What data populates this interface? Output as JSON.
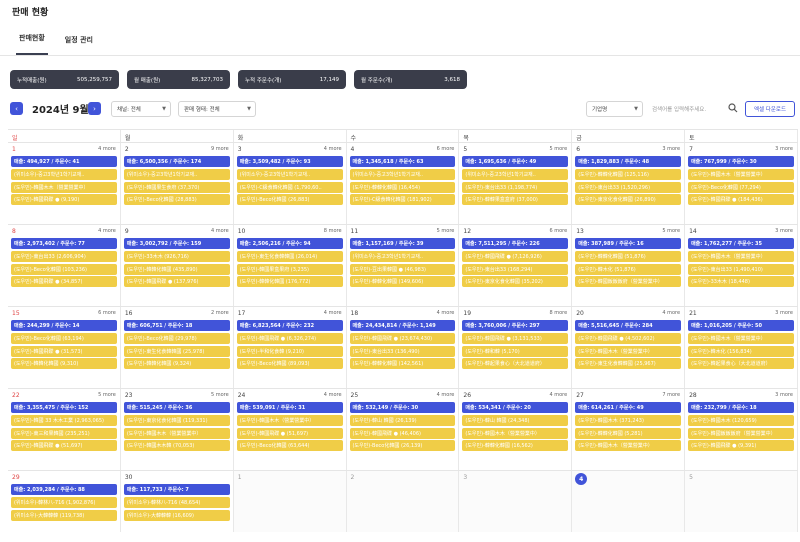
{
  "page_title": "판매 현황",
  "tabs": [
    {
      "label": "판매현황"
    },
    {
      "label": "일정 관리"
    }
  ],
  "stats": [
    {
      "label": "누적매출(원)",
      "value": "505,259,757"
    },
    {
      "label": "월 매출(원)",
      "value": "85,327,703"
    },
    {
      "label": "누적 주문수(개)",
      "value": "17,149"
    },
    {
      "label": "월 주문수(개)",
      "value": "3,618"
    }
  ],
  "controls": {
    "prev": "‹",
    "next": "›",
    "month": "2024년 9월",
    "channel": "채널: 전체",
    "sales_type": "판매 형태: 전체",
    "company": "기업명",
    "search_placeholder": "검색어를 입력해주세요.",
    "excel": "엑셀 다운로드"
  },
  "days_of_week": [
    "일",
    "월",
    "화",
    "수",
    "목",
    "금",
    "토"
  ],
  "weeks": [
    [
      {
        "date": "1",
        "more": "4 more",
        "events": [
          "매출: 494,927 / 주문수: 41",
          "(위미소우)-중고3학년1학기교재..",
          "(도우민)-韓國木木（營業營業中）",
          "(도우민)-韓國飛碟 ● (9,190)"
        ]
      },
      {
        "date": "2",
        "more": "9 more",
        "events": [
          "매출: 6,500,356 / 주문수: 174",
          "(위미소우)-중고3학년1학기교재..",
          "(도우민)-韓國果生食府 (37,370)",
          "(도우민)-Beco化韓國 (28,883)"
        ]
      },
      {
        "date": "3",
        "more": "4 more",
        "events": [
          "매출: 3,509,482 / 주문수: 93",
          "(위미소우)-중고3학년1학기교재..",
          "(도우민)-C級食韓化韓國 (1,790,60..",
          "(도우민)-Beco化韓國 (26,883)"
        ]
      },
      {
        "date": "4",
        "more": "6 more",
        "events": [
          "매출: 1,345,618 / 주문수: 63",
          "(위미소우)-중고3학년1학기교재..",
          "(도우민)-韓韓化韓國 (16,454)",
          "(도우민)-C級食韓化韓國 (181,902)"
        ]
      },
      {
        "date": "5",
        "more": "5 more",
        "events": [
          "매출: 1,695,636 / 주문수: 49",
          "(위미소우)-중고3학년1학기교재..",
          "(도우민)-東台出33 (1,198,774)",
          "(도우민)-韓韓果盒盒府 (37,000)"
        ]
      },
      {
        "date": "6",
        "more": "3 more",
        "events": [
          "매출: 1,829,883 / 주문수: 48",
          "(도우민)-韓韓化韓國 (125,116)",
          "(도우민)-東台出33 (1,520,296)",
          "(도우민)-東京化食化韓國 (26,890)"
        ]
      },
      {
        "date": "7",
        "more": "3 more",
        "events": [
          "매출: 767,999 / 주문수: 30",
          "(도우민)-韓國木木（營業營業中）",
          "(도우민)-Beco化韓國 (77,294)",
          "(도우민)-韓國飛碟 ● (184,436)"
        ]
      }
    ],
    [
      {
        "date": "8",
        "more": "4 more",
        "events": [
          "매출: 2,973,402 / 주문수: 77",
          "(도우민)-東台出33 (2,606,904)",
          "(도우민)-Beco化韓國 (103,236)",
          "(도우민)-韓國飛碟 ● (34,857)"
        ]
      },
      {
        "date": "9",
        "more": "4 more",
        "events": [
          "매출: 3,002,792 / 주문수: 159",
          "(도우민)-33木木 (926,716)",
          "(도우민)-韓韓化韓國 (435,890)",
          "(도우민)-韓國飛碟 ● (137,976)"
        ]
      },
      {
        "date": "10",
        "more": "8 more",
        "events": [
          "매출: 2,506,216 / 주문수: 94",
          "(도우민)-東生化食韓韓國 (26,014)",
          "(도우민)-韓國果盒果府 (3,235)",
          "(도우민)-韓韓化韓國 (176,772)"
        ]
      },
      {
        "date": "11",
        "more": "5 more",
        "events": [
          "매출: 1,157,169 / 주문수: 39",
          "(위미소우)-중고3학년1학기교재..",
          "(도우민)-豆出果韓國 ● (46,983)",
          "(도우민)-韓韓化韓國 (149,606)"
        ]
      },
      {
        "date": "12",
        "more": "6 more",
        "events": [
          "매출: 7,511,295 / 주문수: 226",
          "(도우민)-韓國飛碟 ● (7,126,926)",
          "(도우민)-東台出33 (168,294)",
          "(도우민)-東京化食化韓國 (35,202)"
        ]
      },
      {
        "date": "13",
        "more": "5 more",
        "events": [
          "매출: 387,989 / 주문수: 16",
          "(도우민)-韓韓化韓國 (51,876)",
          "(도우민)-韓木化 (51,876)",
          "(도우민)-韓國飯飯飯府（營業營業中）"
        ]
      },
      {
        "date": "14",
        "more": "3 more",
        "events": [
          "매출: 1,762,277 / 주문수: 35",
          "(도우민)-韓國木木（營業營業中）",
          "(도우민)-東台出33 (1,490,410)",
          "(도우민)-33木木 (18,448)"
        ]
      }
    ],
    [
      {
        "date": "15",
        "more": "6 more",
        "events": [
          "매출: 244,299 / 주문수: 14",
          "(도우민)-Beco化韓國 (63,194)",
          "(도우민)-韓國飛碟 ● (31,573)",
          "(도우민)-韓韓化韓國 (9,310)"
        ]
      },
      {
        "date": "16",
        "more": "2 more",
        "events": [
          "매출: 606,751 / 주문수: 18",
          "(도우민)-Beco化韓國 (29,978)",
          "(도우민)-東生化食韓韓國 (25,978)",
          "(도우민)-韓韓化韓國 (9,324)"
        ]
      },
      {
        "date": "17",
        "more": "4 more",
        "events": [
          "매출: 6,823,564 / 주문수: 232",
          "(도우민)-韓國飛碟 ● (6,326,274)",
          "(도우민)-半和化食韓 (9,210)",
          "(도우민)-Beco化韓國 (89,093)"
        ]
      },
      {
        "date": "18",
        "more": "4 more",
        "events": [
          "매출: 24,434,814 / 주문수: 1,149",
          "(도우민)-韓國飛碟 ● (23,674,430)",
          "(도우민)-東台出33 (136,490)",
          "(도우민)-韓韓化韓國 (142,561)"
        ]
      },
      {
        "date": "19",
        "more": "8 more",
        "events": [
          "매출: 3,760,006 / 주문수: 297",
          "(도우민)-韓國飛碟 ● (3,131,533)",
          "(도우민)-韓和韓 (5,170)",
          "(도우민)-韓起果食心（大北道道府）"
        ]
      },
      {
        "date": "20",
        "more": "4 more",
        "events": [
          "매출: 5,516,645 / 주문수: 284",
          "(도우민)-韓國飛碟 ● (4,502,602)",
          "(도우민)-韓國木木（營業營業中）",
          "(도우민)-東生化食韓韓國 (25,967)"
        ]
      },
      {
        "date": "21",
        "more": "3 more",
        "events": [
          "매출: 1,016,205 / 주문수: 50",
          "(도우민)-韓國木木（營業營業中）",
          "(도우민)-韓木化 (156,834)",
          "(도우민)-韓起果食心（大北道道府）"
        ]
      }
    ],
    [
      {
        "date": "22",
        "more": "5 more",
        "events": [
          "매출: 3,355,475 / 주문수: 152",
          "(도우민)-韓國 33 木木工業 (2,963,065)",
          "(도우민)-東三和果韓國 (235,251)",
          "(도우민)-韓國飛碟 ● (51,697)"
        ]
      },
      {
        "date": "23",
        "more": "5 more",
        "events": [
          "매출: 515,245 / 주문수: 36",
          "(도우민)-東京化食化韓國 (119,331)",
          "(도우민)-韓國木木（營業營業中）",
          "(도우민)-韓國木木韓 (70,053)"
        ]
      },
      {
        "date": "24",
        "more": "4 more",
        "events": [
          "매출: 539,091 / 주문수: 31",
          "(도우민)-韓國木木（營業營業中）",
          "(도우민)-韓國飛碟 ● (51,697)",
          "(도우민)-Beco化韓國 (63,644)"
        ]
      },
      {
        "date": "25",
        "more": "4 more",
        "events": [
          "매출: 532,149 / 주문수: 30",
          "(도우민)-韓山 韓國 (26,139)",
          "(도우민)-韓國飛碟 ● (46,406)",
          "(도우민)-Beco化韓國 (26,139)"
        ]
      },
      {
        "date": "26",
        "more": "4 more",
        "events": [
          "매출: 534,341 / 주문수: 20",
          "(도우민)-韓山 韓國 (24,348)",
          "(도우민)-韓國木木（營業營業中）",
          "(도우민)-韓韓化韓國 (16,562)"
        ]
      },
      {
        "date": "27",
        "more": "7 more",
        "events": [
          "매출: 614,261 / 주문수: 49",
          "(도우민)-韓國木木 (371,243)",
          "(도우민)-韓韓化韓國 (5,281)",
          "(도우민)-韓國木木（營業營業中）"
        ]
      },
      {
        "date": "28",
        "more": "3 more",
        "events": [
          "매출: 232,799 / 주문수: 18",
          "(도우민)-韓國木木 (120,659)",
          "(도우민)-韓國飯飯飯府（營業營業中）",
          "(도우민)-韓國飛碟 ● (9,391)"
        ]
      }
    ],
    [
      {
        "date": "29",
        "more": "",
        "events": [
          "매출: 2,039,284 / 주문수: 88",
          "(위미소우)-韓林八-716 (1,902,876)",
          "(위미소우)-大韓韓韓 (119,738)"
        ]
      },
      {
        "date": "30",
        "more": "",
        "events": [
          "매출: 117,733 / 주문수: 7",
          "(위미소우)-韓林八-716 (48,654)",
          "(위미소우)-大韓韓韓 (16,609)"
        ]
      },
      {
        "date": "1",
        "more": "",
        "events": []
      },
      {
        "date": "2",
        "more": "",
        "events": []
      },
      {
        "date": "3",
        "more": "",
        "events": []
      },
      {
        "date": "4",
        "more": "",
        "events": []
      },
      {
        "date": "5",
        "more": "",
        "events": []
      }
    ]
  ],
  "colors": {
    "accent": "#4154d9",
    "event_yellow": "#f0cd47",
    "sunday": "#e04444",
    "stat_bg": "#3a3d4a"
  }
}
